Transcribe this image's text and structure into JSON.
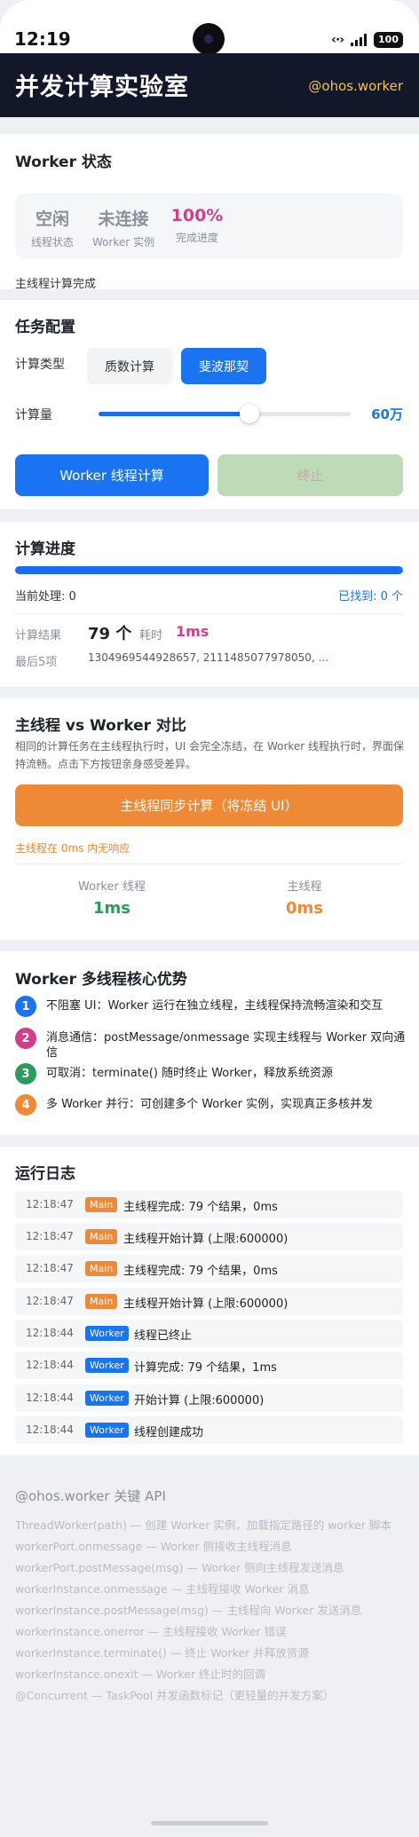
{
  "status_bar": {
    "time": "12:19",
    "battery": "100"
  },
  "header": {
    "title": "并发计算实验室",
    "tag": "@ohos.worker"
  },
  "worker_status": {
    "heading": "Worker 状态",
    "stats": [
      {
        "value": "空闲",
        "label": "线程状态"
      },
      {
        "value": "未连接",
        "label": "Worker 实例"
      },
      {
        "value": "100%",
        "label": "完成进度"
      }
    ],
    "note": "主线程计算完成"
  },
  "task_config": {
    "heading": "任务配置",
    "type_label": "计算类型",
    "types": [
      "质数计算",
      "斐波那契"
    ],
    "selected_type": "斐波那契",
    "amount_label": "计算量",
    "amount_value": "60万",
    "amount_fraction": 0.6,
    "start_button": "Worker 线程计算",
    "stop_button": "终止"
  },
  "progress": {
    "heading": "计算进度",
    "percent": 100,
    "current": "当前处理: 0",
    "found": "已找到: 0 个",
    "result_label": "计算结果",
    "result_count": "79 个",
    "time_label": "耗时",
    "time_value": "1ms",
    "last_label": "最后5项",
    "last_items": "1304969544928657, 2111485077978050, ..."
  },
  "compare": {
    "heading": "主线程 vs Worker 对比",
    "description": "相同的计算任务在主线程执行时，UI 会完全冻结，在 Worker 线程执行时，界面保持流畅。点击下方按钮亲身感受差异。",
    "sync_button": "主线程同步计算（将冻结 UI）",
    "freeze_note": "主线程在 0ms 内无响应",
    "worker_label": "Worker 线程",
    "worker_value": "1ms",
    "main_label": "主线程",
    "main_value": "0ms"
  },
  "advantages": {
    "heading": "Worker 多线程核心优势",
    "items": [
      {
        "num": "1",
        "text": "不阻塞 UI：Worker 运行在独立线程，主线程保持流畅渲染和交互",
        "color": "#1a73f0"
      },
      {
        "num": "2",
        "text": "消息通信：postMessage/onmessage 实现主线程与 Worker 双向通信",
        "color": "#cf3f8b"
      },
      {
        "num": "3",
        "text": "可取消：terminate() 随时终止 Worker，释放系统资源",
        "color": "#2e9a5e"
      },
      {
        "num": "4",
        "text": "多 Worker 并行：可创建多个 Worker 实例，实现真正多核并发",
        "color": "#ee8a37"
      }
    ]
  },
  "logs": {
    "heading": "运行日志",
    "entries": [
      {
        "time": "12:18:47",
        "tag": "Main",
        "msg": "主线程完成: 79 个结果，0ms"
      },
      {
        "time": "12:18:47",
        "tag": "Main",
        "msg": "主线程开始计算 (上限:600000)"
      },
      {
        "time": "12:18:47",
        "tag": "Main",
        "msg": "主线程完成: 79 个结果，0ms"
      },
      {
        "time": "12:18:47",
        "tag": "Main",
        "msg": "主线程开始计算 (上限:600000)"
      },
      {
        "time": "12:18:44",
        "tag": "Worker",
        "msg": "线程已终止"
      },
      {
        "time": "12:18:44",
        "tag": "Worker",
        "msg": "计算完成: 79 个结果，1ms"
      },
      {
        "time": "12:18:44",
        "tag": "Worker",
        "msg": "开始计算 (上限:600000)"
      },
      {
        "time": "12:18:44",
        "tag": "Worker",
        "msg": "线程创建成功"
      }
    ]
  },
  "api": {
    "heading": "@ohos.worker 关键 API",
    "lines": [
      "ThreadWorker(path) — 创建 Worker 实例，加载指定路径的 worker 脚本",
      "workerPort.onmessage — Worker 侧接收主线程消息",
      "workerPort.postMessage(msg) — Worker 侧向主线程发送消息",
      "workerInstance.onmessage — 主线程接收 Worker 消息",
      "workerInstance.postMessage(msg) — 主线程向 Worker 发送消息",
      "workerInstance.onerror — 主线程接收 Worker 错误",
      "workerInstance.terminate() — 终止 Worker 并释放资源",
      "workerInstance.onexit — Worker 终止时的回调",
      "@Concurrent — TaskPool 并发函数标记（更轻量的并发方案）"
    ]
  }
}
